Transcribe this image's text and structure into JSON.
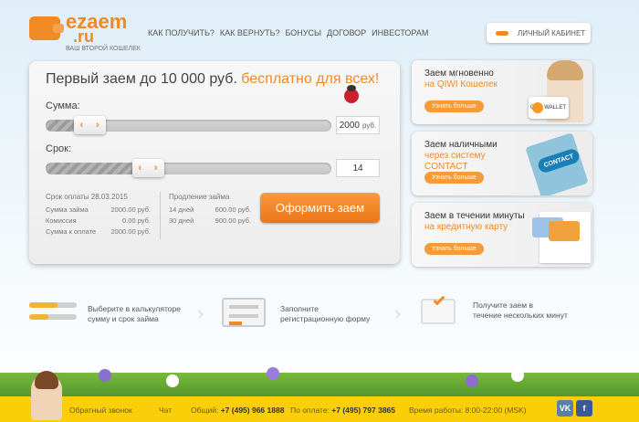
{
  "brand": {
    "name_1": "ezaem",
    "name_2": ".ru",
    "tagline": "ВАШ ВТОРОЙ КОШЕЛЕК"
  },
  "nav": [
    "КАК ПОЛУЧИТЬ?",
    "КАК ВЕРНУТЬ?",
    "БОНУСЫ",
    "ДОГОВОР",
    "ИНВЕСТОРАМ"
  ],
  "account": {
    "label": "ЛИЧНЫЙ КАБИНЕТ"
  },
  "calc": {
    "title": "Первый заем до 10 000 руб.",
    "title_accent": "бесплатно для всех!",
    "sum_label": "Сумма:",
    "sum_value": "2000",
    "sum_unit": "руб.",
    "sum_fraction": 0.11,
    "term_label": "Срок:",
    "term_value": "14",
    "term_fraction": 0.34,
    "due_text": "Срок оплаты 28.03.2015",
    "rows": [
      {
        "k": "Сумма займа",
        "v": "2000.00 руб."
      },
      {
        "k": "Комиссия",
        "v": "0.00 руб."
      },
      {
        "k": "Сумма к оплате",
        "v": "2000.00 руб."
      }
    ],
    "ext_title": "Продление займа",
    "ext_rows": [
      {
        "k": "14 дней",
        "v": "600.00 руб."
      },
      {
        "k": "30 дней",
        "v": "900.00 руб."
      }
    ],
    "button": "Оформить заем"
  },
  "cards": [
    {
      "title": "Заем мгновенно",
      "accent": "на QIWI Кошелек",
      "more": "Узнать больше",
      "logo": "QIWI WALLET"
    },
    {
      "title": "Заем наличными",
      "accent": "через систему CONTACT",
      "more": "Узнать больше",
      "logo": "CONTACT"
    },
    {
      "title": "Заем в течении минуты",
      "accent": "на кредитную карту",
      "more": "Узнать больше"
    }
  ],
  "steps": [
    {
      "text1": "Выберите в калькуляторе",
      "text2": "сумму и срок займа"
    },
    {
      "text1": "Заполните",
      "text2": "регистрационную форму"
    },
    {
      "text1": "Получите заем в",
      "text2": "течение нескольких минут"
    }
  ],
  "footer": {
    "callback": "Обратный звонок",
    "chat": "Чат",
    "general_label": "Общий:",
    "general_phone": "+7 (495) 966 1888",
    "pay_label": "По оплате:",
    "pay_phone": "+7 (495) 797 3865",
    "hours": "Время работы: 8:00-22:00 (MSK)",
    "vk": "VK",
    "fb": "f"
  },
  "colors": {
    "accent": "#f08a24",
    "footer": "#fbce0a"
  }
}
